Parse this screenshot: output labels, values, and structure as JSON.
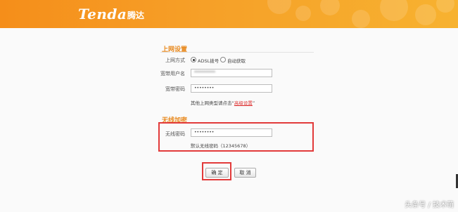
{
  "header": {
    "logo_text": "Tenda",
    "logo_cn": "腾达"
  },
  "internet_settings": {
    "section_title": "上网设置",
    "connection_type_label": "上网方式",
    "options": [
      "ADSL拨号",
      "自动获取"
    ],
    "selected_option": "ADSL拨号",
    "username_label": "宽带用户名",
    "username_value": "**********",
    "password_label": "宽带密码",
    "password_value": "••••••••",
    "hint_prefix": "其他上网类型请点击“",
    "hint_link": "高级设置",
    "hint_suffix": "”"
  },
  "wireless_encryption": {
    "section_title": "无线加密",
    "password_label": "无线密码",
    "password_value": "••••••••",
    "default_hint": "默认无线密码（12345678）"
  },
  "buttons": {
    "confirm": "确 定",
    "cancel": "取 消"
  },
  "watermark": "头条号 / 技术萌",
  "colors": {
    "header_orange": "#f6a028",
    "section_title": "#e8891e",
    "highlight_red": "#e23a3a",
    "link_red": "#dd3333"
  }
}
